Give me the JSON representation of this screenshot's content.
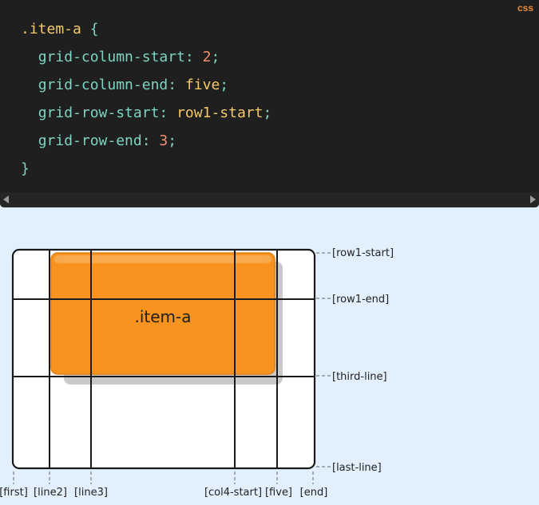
{
  "code_panel": {
    "language": "css",
    "lines": {
      "selector": ".item-a",
      "open_brace": "{",
      "close_brace": "}",
      "decl1_prop": "grid-column-start",
      "decl1_value": "2",
      "decl2_prop": "grid-column-end",
      "decl2_value": "five",
      "decl3_prop": "grid-row-start",
      "decl3_value": "row1-start",
      "decl4_prop": "grid-row-end",
      "decl4_value": "3"
    }
  },
  "diagram": {
    "item_label": ".item-a",
    "row_line_labels": [
      "[row1-start]",
      "[row1-end]",
      "[third-line]",
      "[last-line]"
    ],
    "column_line_labels": [
      "[first]",
      "[line2]",
      "[line3]",
      "[col4-start]",
      "[five]",
      "[end]"
    ],
    "item_color": "#f7931e"
  }
}
